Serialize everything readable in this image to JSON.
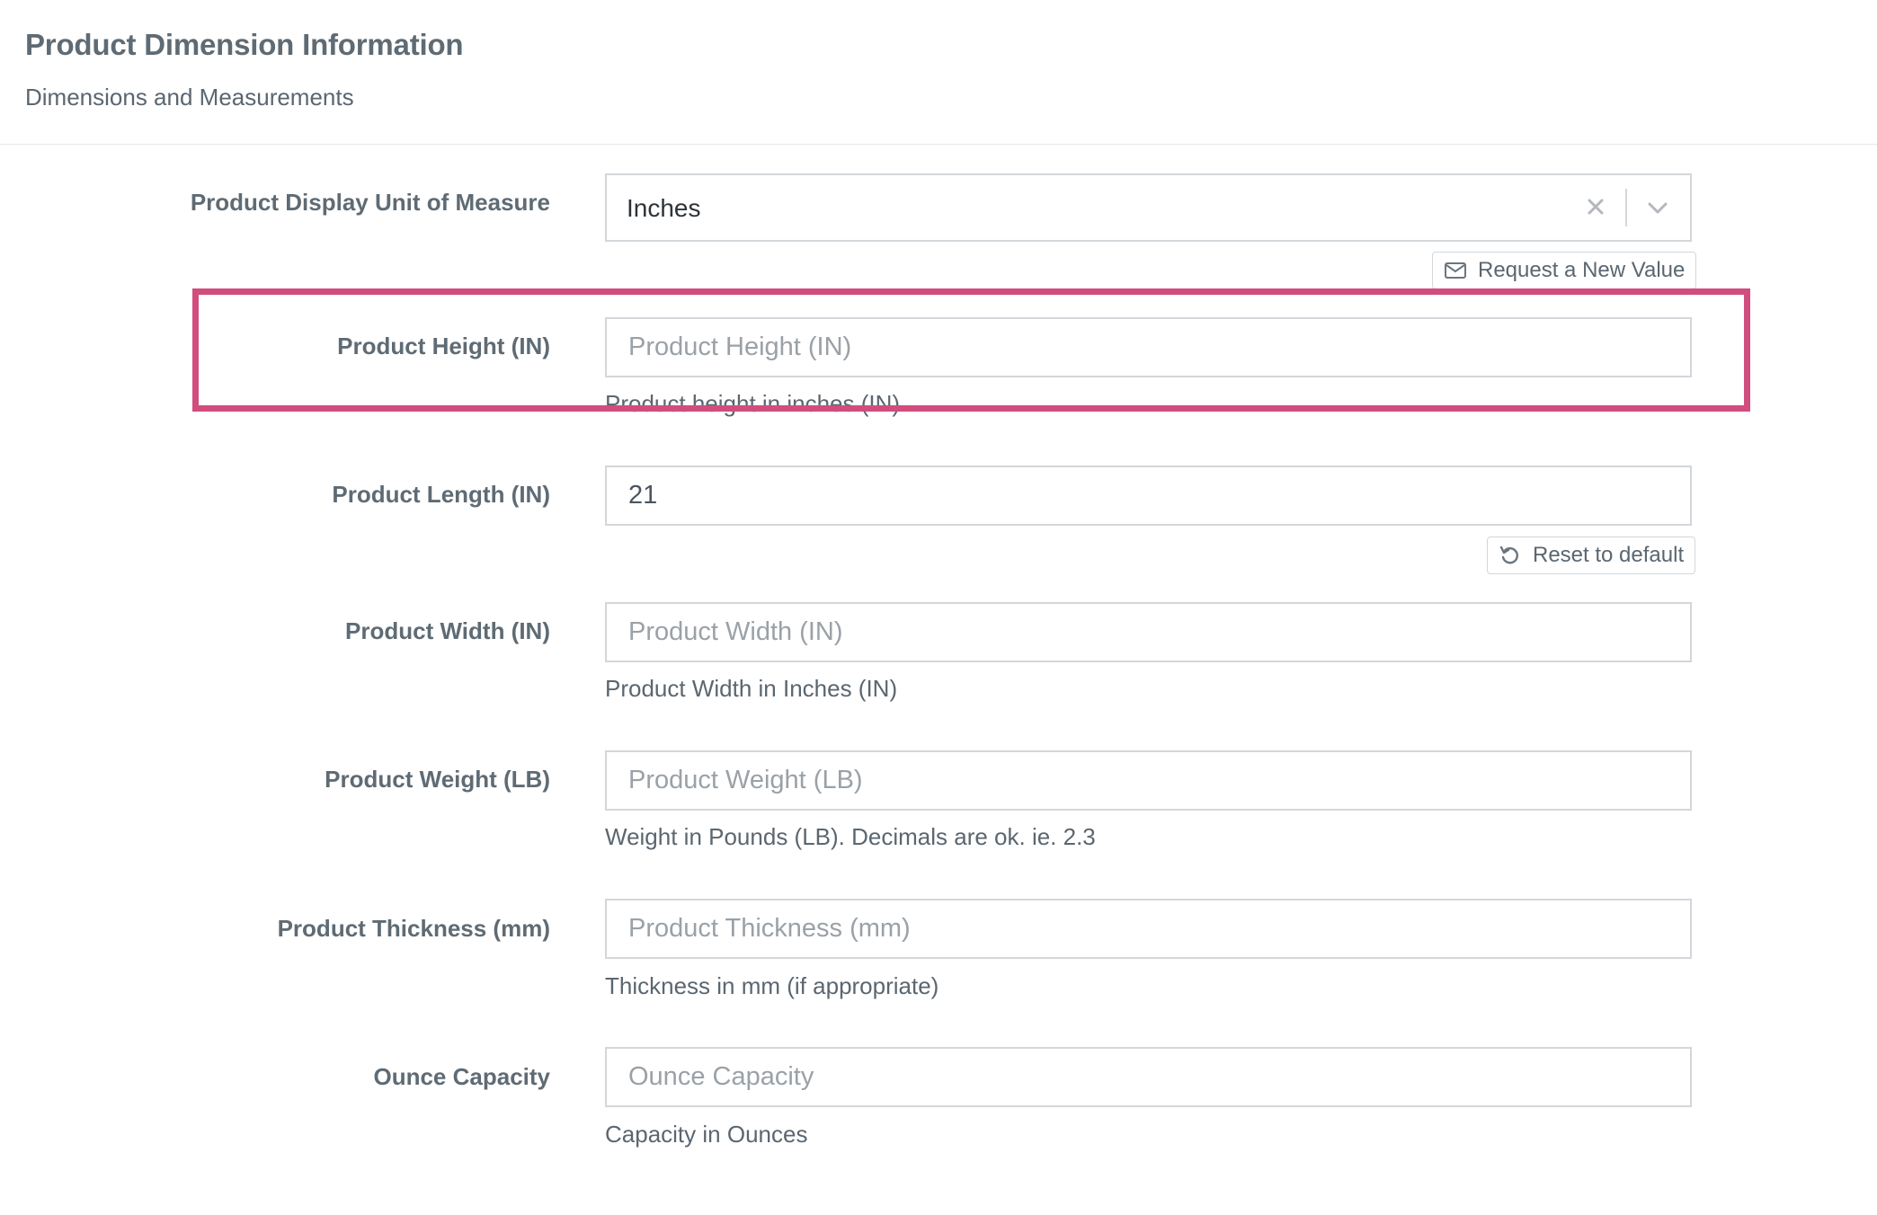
{
  "header": {
    "title": "Product Dimension Information",
    "subtitle": "Dimensions and Measurements"
  },
  "unit_of_measure": {
    "label": "Product Display Unit of Measure",
    "value": "Inches",
    "clear_icon": "close-icon",
    "dropdown_icon": "chevron-down-icon",
    "request_button": "Request a New Value",
    "request_icon": "envelope-icon"
  },
  "height": {
    "label": "Product Height (IN)",
    "placeholder": "Product Height (IN)",
    "help": "Product height in inches (IN)"
  },
  "length": {
    "label": "Product Length (IN)",
    "value": "21",
    "reset_button": "Reset to default",
    "reset_icon": "undo-icon"
  },
  "width": {
    "label": "Product Width (IN)",
    "placeholder": "Product Width (IN)",
    "help": "Product Width in Inches (IN)"
  },
  "weight": {
    "label": "Product Weight (LB)",
    "placeholder": "Product Weight (LB)",
    "help": "Weight in Pounds (LB). Decimals are ok. ie. 2.3"
  },
  "thickness": {
    "label": "Product Thickness (mm)",
    "placeholder": "Product Thickness (mm)",
    "help": "Thickness in mm (if appropriate)"
  },
  "ounce": {
    "label": "Ounce Capacity",
    "placeholder": "Ounce Capacity",
    "help": "Capacity in Ounces"
  },
  "colors": {
    "highlight": "#d14d7d",
    "border": "#d3d7db",
    "text": "#5b6670"
  }
}
